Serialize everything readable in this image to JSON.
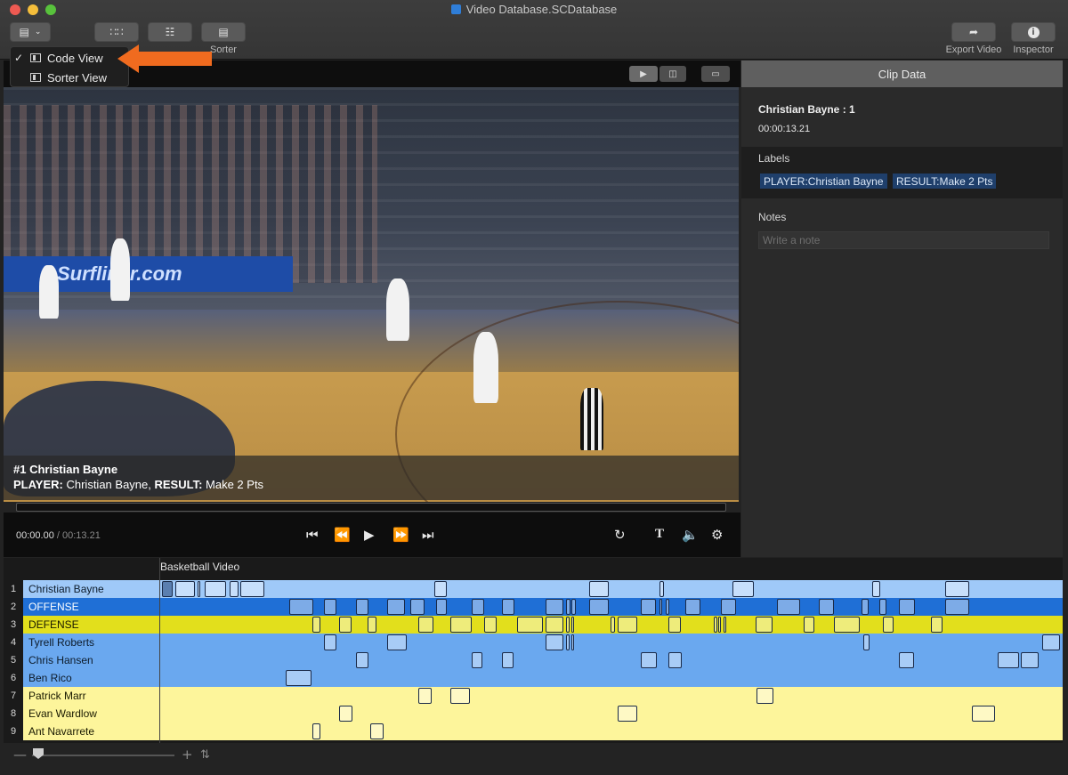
{
  "window": {
    "title": "Video Database.SCDatabase"
  },
  "toolbar": {
    "view_button_icon": "view-switch-icon",
    "sorter_label": "Sorter",
    "export_label": "Export Video",
    "inspector_label": "Inspector"
  },
  "view_menu": {
    "items": [
      {
        "label": "Code View",
        "checked": true
      },
      {
        "label": "Sorter View",
        "checked": false
      }
    ]
  },
  "video": {
    "caption_title": "#1 Christian Bayne",
    "caption_player_key": "PLAYER:",
    "caption_player_value": " Christian Bayne, ",
    "caption_result_key": "RESULT:",
    "caption_result_value": " Make 2 Pts",
    "banner_text": "Surfliner.com",
    "current_time": "00:00.00",
    "separator": " / ",
    "duration": "00:13.21",
    "progress": 0.0
  },
  "clip_data": {
    "header": "Clip Data",
    "name": "Christian Bayne : 1",
    "time": "00:00:13.21",
    "labels_title": "Labels",
    "labels": [
      "PLAYER:Christian Bayne",
      "RESULT:Make 2 Pts"
    ],
    "notes_title": "Notes",
    "notes_placeholder": "Write a note"
  },
  "timeline": {
    "title": "Basketball Video",
    "rows": [
      {
        "num": "1",
        "name": "Christian Bayne",
        "color": "#9fc9f8",
        "text_color": "#0d1b2a"
      },
      {
        "num": "2",
        "name": "OFFENSE",
        "color": "#1f6fd6",
        "text_color": "#ffffff"
      },
      {
        "num": "3",
        "name": "DEFENSE",
        "color": "#e2df1c",
        "text_color": "#1a1a00"
      },
      {
        "num": "4",
        "name": "Tyrell Roberts",
        "color": "#6aa8ef",
        "text_color": "#0d1b2a"
      },
      {
        "num": "5",
        "name": "Chris Hansen",
        "color": "#6aa8ef",
        "text_color": "#0d1b2a"
      },
      {
        "num": "6",
        "name": "Ben Rico",
        "color": "#6aa8ef",
        "text_color": "#0d1b2a"
      },
      {
        "num": "7",
        "name": "Patrick Marr",
        "color": "#fdf59b",
        "text_color": "#1a1a00"
      },
      {
        "num": "8",
        "name": "Evan Wardlow",
        "color": "#fdf59b",
        "text_color": "#1a1a00"
      },
      {
        "num": "9",
        "name": "Ant Navarrete",
        "color": "#fdf59b",
        "text_color": "#1a1a00"
      }
    ]
  }
}
